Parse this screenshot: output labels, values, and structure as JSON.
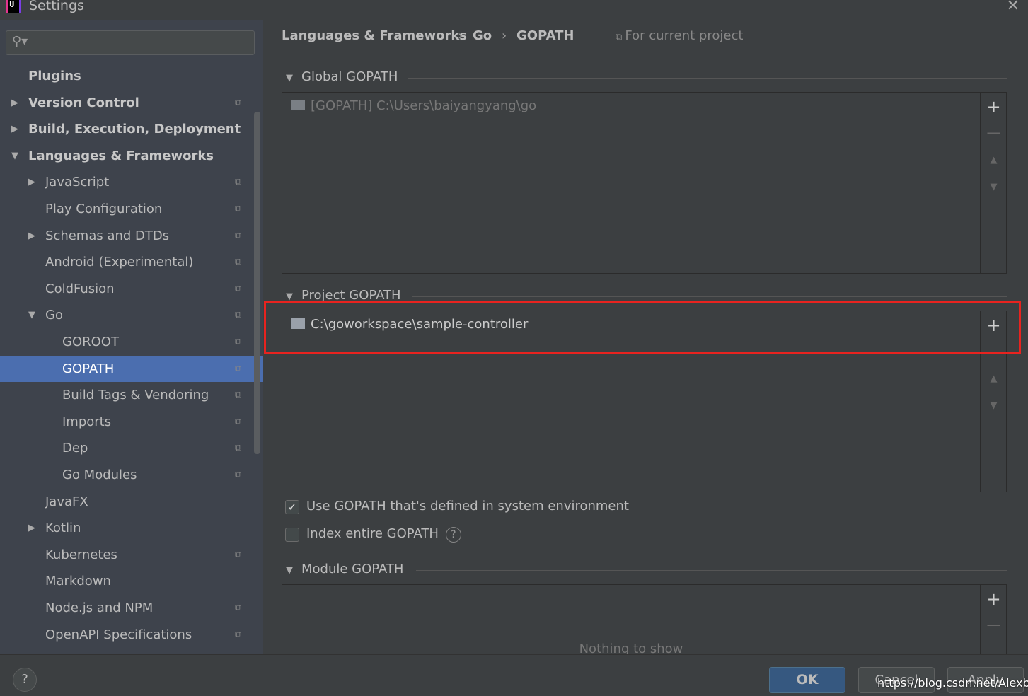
{
  "window": {
    "title": "Settings"
  },
  "sidebar": {
    "items": [
      {
        "label": "Plugins",
        "level": 0,
        "bold": true,
        "arrow": "",
        "copy": false
      },
      {
        "label": "Version Control",
        "level": 0,
        "bold": true,
        "arrow": "▶",
        "copy": true
      },
      {
        "label": "Build, Execution, Deployment",
        "level": 0,
        "bold": true,
        "arrow": "▶",
        "copy": false
      },
      {
        "label": "Languages & Frameworks",
        "level": 0,
        "bold": true,
        "arrow": "▼",
        "copy": false
      },
      {
        "label": "JavaScript",
        "level": 1,
        "arrow": "▶",
        "copy": true
      },
      {
        "label": "Play Configuration",
        "level": 1,
        "arrow": "",
        "copy": true
      },
      {
        "label": "Schemas and DTDs",
        "level": 1,
        "arrow": "▶",
        "copy": true
      },
      {
        "label": "Android (Experimental)",
        "level": 1,
        "arrow": "",
        "copy": true
      },
      {
        "label": "ColdFusion",
        "level": 1,
        "arrow": "",
        "copy": true
      },
      {
        "label": "Go",
        "level": 1,
        "arrow": "▼",
        "copy": true
      },
      {
        "label": "GOROOT",
        "level": 2,
        "arrow": "",
        "copy": true
      },
      {
        "label": "GOPATH",
        "level": 2,
        "arrow": "",
        "copy": true,
        "selected": true
      },
      {
        "label": "Build Tags & Vendoring",
        "level": 2,
        "arrow": "",
        "copy": true
      },
      {
        "label": "Imports",
        "level": 2,
        "arrow": "",
        "copy": true
      },
      {
        "label": "Dep",
        "level": 2,
        "arrow": "",
        "copy": true
      },
      {
        "label": "Go Modules",
        "level": 2,
        "arrow": "",
        "copy": true
      },
      {
        "label": "JavaFX",
        "level": 1,
        "arrow": "",
        "copy": false
      },
      {
        "label": "Kotlin",
        "level": 1,
        "arrow": "▶",
        "copy": false
      },
      {
        "label": "Kubernetes",
        "level": 1,
        "arrow": "",
        "copy": true
      },
      {
        "label": "Markdown",
        "level": 1,
        "arrow": "",
        "copy": false
      },
      {
        "label": "Node.js and NPM",
        "level": 1,
        "arrow": "",
        "copy": true
      },
      {
        "label": "OpenAPI Specifications",
        "level": 1,
        "arrow": "",
        "copy": true
      }
    ]
  },
  "breadcrumb": [
    "Languages & Frameworks",
    "Go",
    "GOPATH"
  ],
  "for_current_project": "For current project",
  "global": {
    "title": "Global GOPATH",
    "entry": "[GOPATH] C:\\Users\\baiyangyang\\go"
  },
  "project": {
    "title": "Project GOPATH",
    "entry": "C:\\goworkspace\\sample-controller"
  },
  "options": {
    "use_system": {
      "label": "Use GOPATH that's defined in system environment",
      "checked": true
    },
    "index_entire": {
      "label": "Index entire GOPATH",
      "checked": false
    }
  },
  "module": {
    "title": "Module GOPATH",
    "empty": "Nothing to show"
  },
  "footer": {
    "ok": "OK",
    "cancel": "Cancel",
    "apply": "Apply",
    "help": "?"
  },
  "watermark": "https://blog.csdn.net/Alexbyy",
  "colors": {
    "selection": "#4b6eaf",
    "highlight": "#e8231f",
    "ok": "#365880"
  }
}
